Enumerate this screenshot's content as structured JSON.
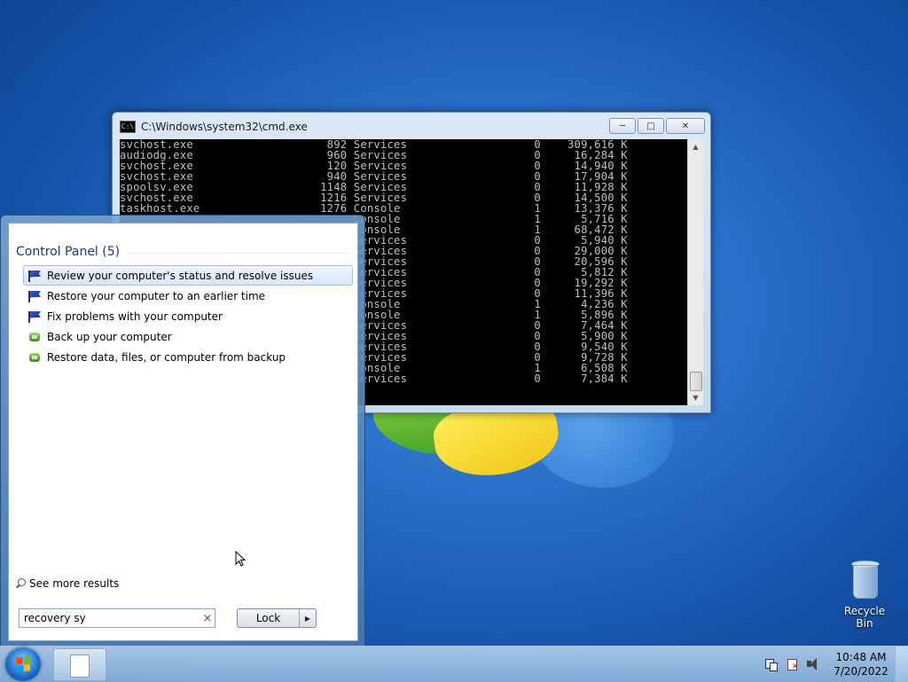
{
  "cmd": {
    "title": "C:\\Windows\\system32\\cmd.exe",
    "icon_label": "C:\\",
    "minimize": "─",
    "maximize": "□",
    "close": "✕",
    "lines": [
      "svchost.exe                    892 Services                   0    309,616 K",
      "audiodg.exe                    960 Services                   0     16,284 K",
      "svchost.exe                    120 Services                   0     14,940 K",
      "svchost.exe                    940 Services                   0     17,904 K",
      "spoolsv.exe                   1148 Services                   0     11,928 K",
      "svchost.exe                   1216 Services                   0     14,500 K",
      "taskhost.exe                  1276 Console                    1     13,376 K",
      "                                   Console                    1      5,716 K",
      "                                   Console                    1     68,472 K",
      "                                   Services                   0      5,940 K",
      "                                   Services                   0     29,000 K",
      "                                   Services                   0     20,596 K",
      "                                   Services                   0      5,812 K",
      "                                   Services                   0     19,292 K",
      "                                   Services                   0     11,396 K",
      "                                   Console                    1      4,236 K",
      "                                   Console                    1      5,896 K",
      "                                   Services                   0      7,464 K",
      "                                   Services                   0      5,900 K",
      "                                   Services                   0      9,540 K",
      "                                   Services                   0      9,728 K",
      "                                   Console                    1      6,508 K",
      "                                   Services                   0      7,384 K"
    ],
    "scroll_up": "▲",
    "scroll_down": "▼"
  },
  "start_menu": {
    "heading": "Control Panel (5)",
    "results": [
      {
        "label": "Review your computer's status and resolve issues",
        "icon": "flag-icon"
      },
      {
        "label": "Restore your computer to an earlier time",
        "icon": "flag-icon"
      },
      {
        "label": "Fix problems with your computer",
        "icon": "flag-icon"
      },
      {
        "label": "Back up your computer",
        "icon": "backup-icon"
      },
      {
        "label": "Restore data, files, or computer from backup",
        "icon": "backup-icon"
      }
    ],
    "see_more": "See more results",
    "search_value": "recovery sy",
    "search_clear": "×",
    "lock_label": "Lock",
    "lock_arrow": "▶"
  },
  "desktop": {
    "recycle_bin": "Recycle Bin"
  },
  "taskbar": {
    "time": "10:48 AM",
    "date": "7/20/2022"
  }
}
